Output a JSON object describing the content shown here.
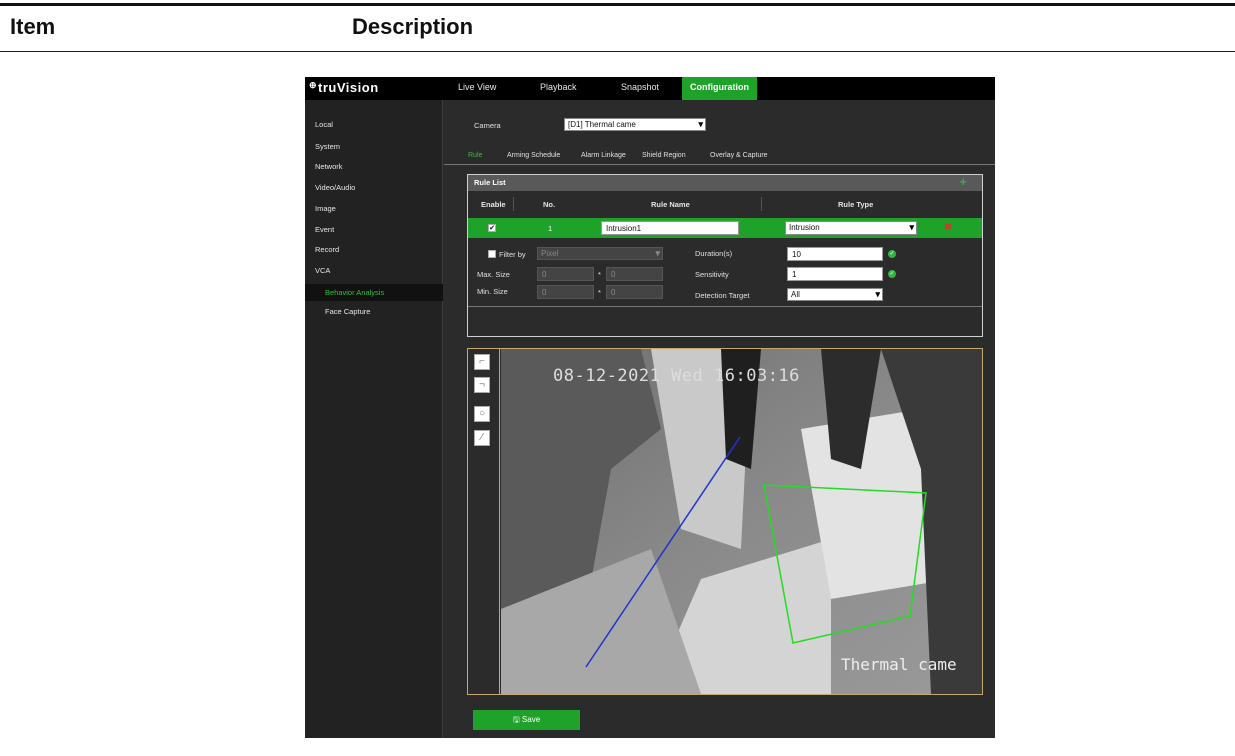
{
  "doc": {
    "col_item": "Item",
    "col_description": "Description"
  },
  "app": {
    "logo": "truVision",
    "logo_badge": "⊕",
    "nav": [
      "Live View",
      "Playback",
      "Snapshot",
      "Configuration"
    ],
    "sidebar": [
      "Local",
      "System",
      "Network",
      "Video/Audio",
      "Image",
      "Event",
      "Record",
      "VCA",
      "Behavior Analysis",
      "Face Capture"
    ],
    "camera_label": "Camera",
    "camera_value": "[D1] Thermal came",
    "subtabs": [
      "Rule",
      "Arming Schedule",
      "Alarm Linkage",
      "Shield Region",
      "Overlay & Capture"
    ],
    "rule_list": {
      "title": "Rule List",
      "add": "+",
      "cols": [
        "Enable",
        "No.",
        "Rule Name",
        "Rule Type"
      ],
      "row": {
        "enabled": "✔",
        "no": "1",
        "name": "Intrusion1",
        "type": "Intrusion",
        "delete": "✖"
      }
    },
    "filter": {
      "filter_by_label": "Filter by",
      "filter_by_value": "Pixel",
      "max_size_label": "Max. Size",
      "max_w": "0",
      "max_h": "0",
      "min_size_label": "Min. Size",
      "min_w": "0",
      "min_h": "0",
      "times": "*",
      "duration_label": "Duration(s)",
      "duration_value": "10",
      "sensitivity_label": "Sensitivity",
      "sensitivity_value": "1",
      "target_label": "Detection Target",
      "target_value": "All"
    },
    "video": {
      "timestamp": "08-12-2021 Wed 16:03:16",
      "camera_name": "Thermal came"
    },
    "save_label": "Save",
    "colors": {
      "accent": "#1fa22a",
      "delete": "#d9362b",
      "line": "#2233cc",
      "zone": "#22dd22"
    }
  }
}
